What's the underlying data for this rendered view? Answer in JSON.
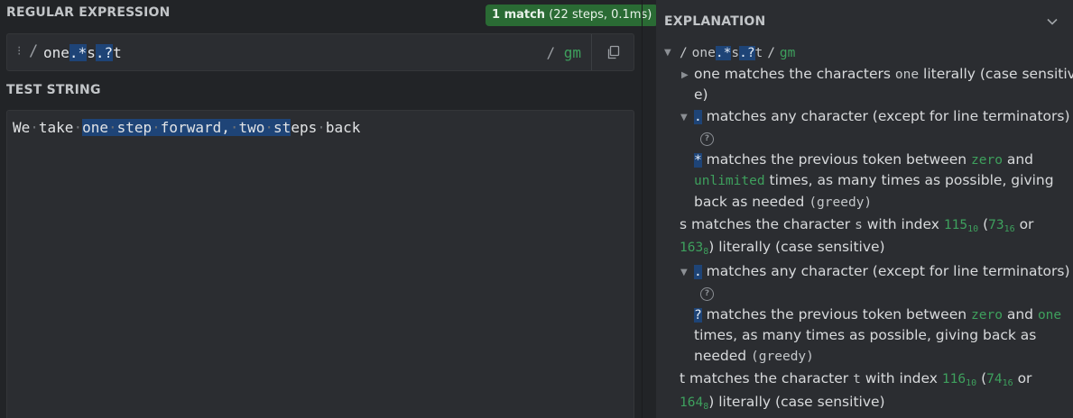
{
  "regex_section": {
    "header": "REGULAR EXPRESSION",
    "match_count": "1 match",
    "match_detail": "(22 steps, 0.1ms)",
    "delimiter": "/",
    "pattern_parts": [
      "one",
      ".",
      "*",
      "s",
      ".",
      "?",
      "t"
    ],
    "flags_slash": "/",
    "flags": "gm"
  },
  "test_section": {
    "header": "TEST STRING",
    "text_before": "We take ",
    "match_words": [
      "one",
      "step",
      "forward,",
      "two",
      "st"
    ],
    "text_after_match": "eps",
    "text_tail": "back"
  },
  "explanation": {
    "header": "EXPLANATION",
    "root_slash": "/",
    "root_pattern_parts": [
      "one",
      ".",
      "*",
      "s",
      ".",
      "?",
      "t"
    ],
    "root_flags_slash": "/",
    "root_flags": "gm",
    "items": {
      "one_prefix": "one",
      "one_line1": " matches the characters ",
      "one_code": "one",
      "one_line1b": " literally (case sensitiv",
      "one_line2": "e)",
      "dot1_token": ".",
      "dot1_text": " matches any character (except for line terminators)",
      "star_token": "*",
      "star_line1a": " matches the previous token between ",
      "star_zero": "zero",
      "star_line1b": " and",
      "star_unlimited": "unlimited",
      "star_line2": " times, as many times as possible, giving",
      "star_line3a": "back as needed ",
      "star_greedy": "(greedy)",
      "s_prefix": "s",
      "s_line1a": " matches the character ",
      "s_code": "s",
      "s_line1b": " with index ",
      "s_dec": "115",
      "s_dec_base": "10",
      "s_paren": " (",
      "s_hex": "73",
      "s_hex_base": "16",
      "s_or": " or",
      "s_oct": "163",
      "s_oct_base": "8",
      "s_line2": ") literally (case sensitive)",
      "dot2_token": ".",
      "dot2_text": " matches any character (except for line terminators)",
      "q_token": "?",
      "q_line1a": " matches the previous token between ",
      "q_zero": "zero",
      "q_and": " and ",
      "q_one": "one",
      "q_line2": "times, as many times as possible, giving back as",
      "q_line3a": "needed ",
      "q_greedy": "(greedy)",
      "t_prefix": "t",
      "t_line1a": " matches the character ",
      "t_code": "t",
      "t_line1b": " with index ",
      "t_dec": "116",
      "t_dec_base": "10",
      "t_paren": " (",
      "t_hex": "74",
      "t_hex_base": "16",
      "t_or": " or",
      "t_oct": "164",
      "t_oct_base": "8",
      "t_line2": ") literally (case sensitive)",
      "help_glyph": "?"
    }
  },
  "colors": {
    "accent_green": "#3ea05d",
    "match_highlight": "#1e4477",
    "badge_bg": "#2a6b34"
  }
}
